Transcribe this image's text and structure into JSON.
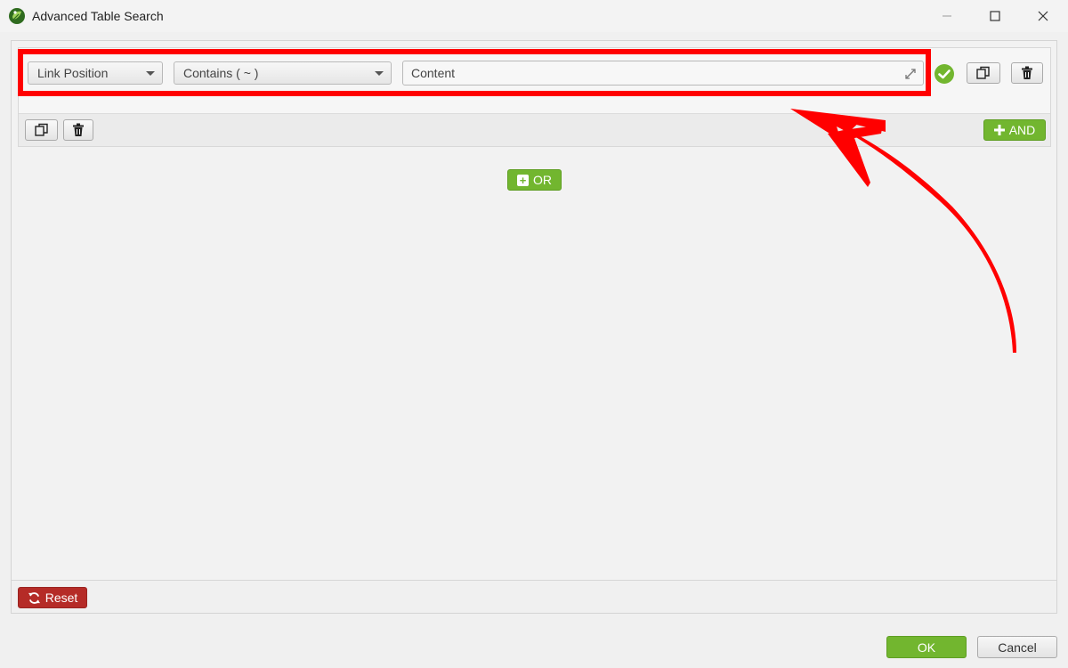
{
  "window": {
    "title": "Advanced Table Search",
    "controls": [
      "minimize",
      "maximize",
      "close"
    ]
  },
  "rule": {
    "field": "Link Position",
    "operator": "Contains ( ~ )",
    "value": "Content",
    "status": "valid"
  },
  "group_footer": {
    "and_label": "AND"
  },
  "or_label": "OR",
  "bottom": {
    "reset_label": "Reset"
  },
  "dialog": {
    "ok_label": "OK",
    "cancel_label": "Cancel"
  },
  "colors": {
    "green": "#72b62f",
    "red": "#b52b27",
    "annotation": "#ff0000"
  },
  "icons": {
    "app": "app-leaf-icon",
    "check": "check-circle-icon",
    "copy": "copy-icon",
    "delete": "trash-icon",
    "expand": "expand-icon",
    "reset": "refresh-icon"
  }
}
